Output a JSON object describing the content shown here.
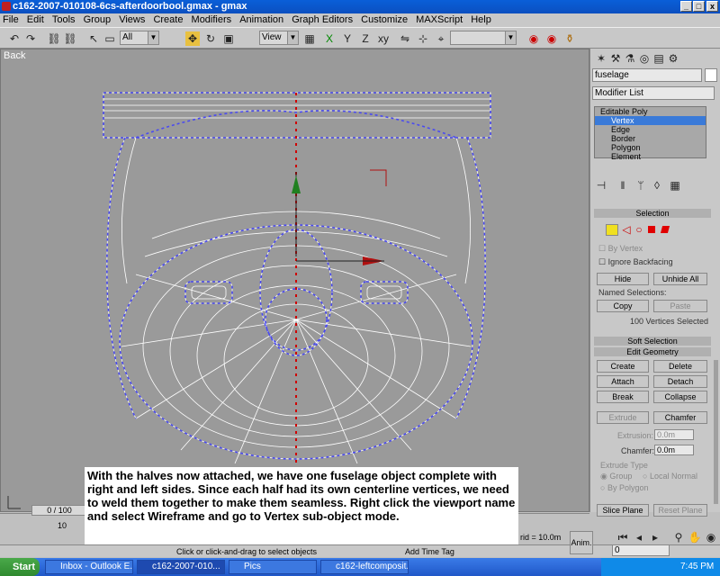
{
  "window": {
    "title": "c162-2007-010108-6cs-afterdoorbool.gmax - gmax"
  },
  "menu": [
    "File",
    "Edit",
    "Tools",
    "Group",
    "Views",
    "Create",
    "Modifiers",
    "Animation",
    "Graph Editors",
    "Customize",
    "MAXScript",
    "Help"
  ],
  "toolbar": {
    "selection_filter": "All",
    "coord_system": "View",
    "named_sel": ""
  },
  "viewport": {
    "name": "Back"
  },
  "panel": {
    "object_name": "fuselage",
    "modifier_list": "Modifier List",
    "stack": [
      "Editable Poly",
      "Vertex",
      "Edge",
      "Border",
      "Polygon",
      "Element"
    ],
    "selection": {
      "title": "Selection",
      "by_vertex": "By Vertex",
      "ignore_backfacing": "Ignore Backfacing",
      "hide": "Hide",
      "unhide_all": "Unhide All",
      "named_selections": "Named Selections:",
      "copy": "Copy",
      "paste": "Paste",
      "status": "100 Vertices Selected"
    },
    "soft_selection": "Soft Selection",
    "edit_geometry": {
      "title": "Edit Geometry",
      "create": "Create",
      "delete": "Delete",
      "attach": "Attach",
      "detach": "Detach",
      "break": "Break",
      "collapse": "Collapse",
      "extrude": "Extrude",
      "chamfer": "Chamfer",
      "extrusion_label": "Extrusion:",
      "extrusion_value": "0.0m",
      "chamfer_label": "Chamfer:",
      "chamfer_value": "0.0m",
      "extrude_type": "Extrude Type",
      "group": "Group",
      "local_normal": "Local Normal",
      "by_polygon": "By Polygon",
      "slice_plane": "Slice Plane",
      "reset_plane": "Reset Plane"
    }
  },
  "timeline": {
    "frame": "0 / 100",
    "tick": "10"
  },
  "status": {
    "prompt": "Click or click-and-drag to select objects",
    "add_time_tag": "Add Time Tag",
    "grid": "rid = 10.0m",
    "anim": "Anim.",
    "frame_field": "0"
  },
  "caption": "With the halves now attached, we have one fuselage object complete with right and left sides.  Since each half had its own centerline vertices, we need to weld them together to make them seamless.  Right click the viewport name and select Wireframe and go to Vertex sub-object mode.",
  "taskbar": {
    "start": "Start",
    "tasks": [
      "Inbox - Outlook E...",
      "c162-2007-010...",
      "Pics",
      "c162-leftcomposit..."
    ],
    "time": "7:45 PM"
  }
}
